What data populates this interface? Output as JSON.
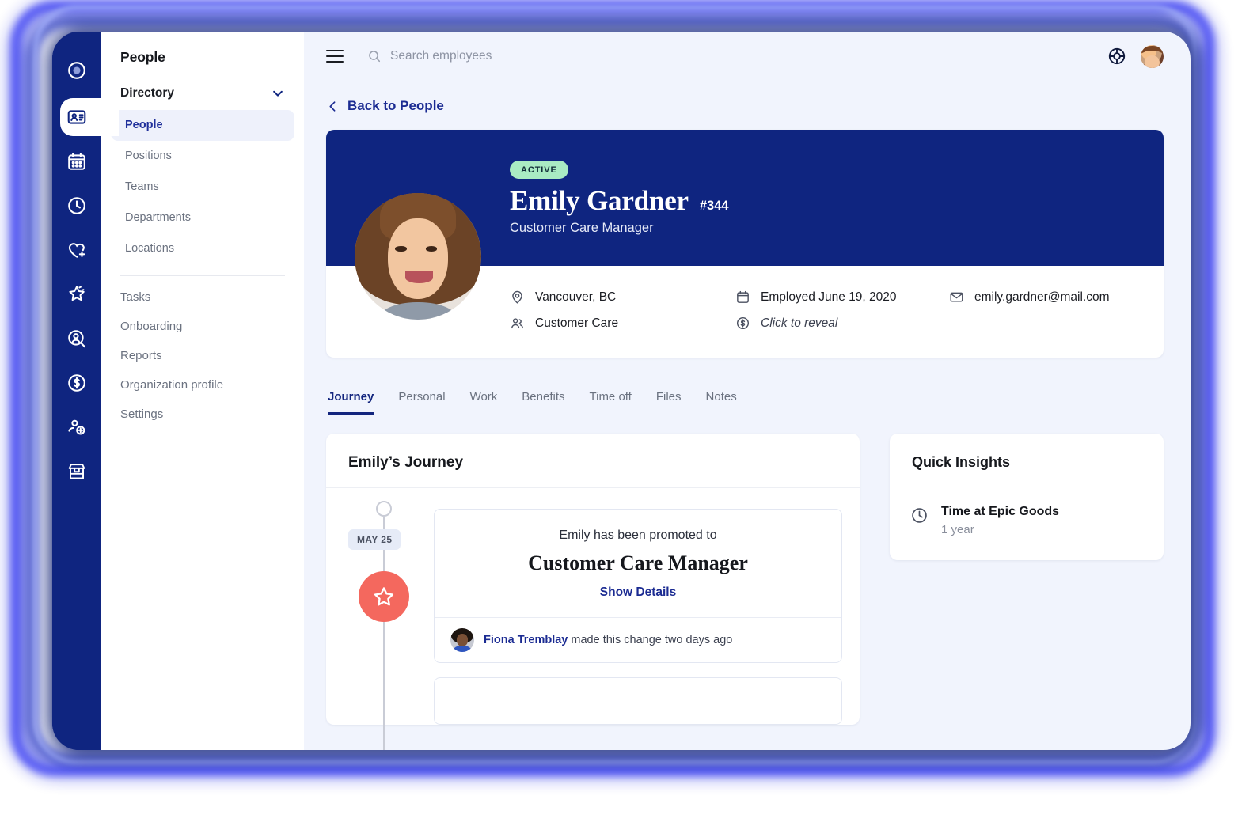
{
  "theme": {
    "navy": "#0f2580",
    "page_bg": "#f1f4fd",
    "accent_link": "#1b2b92",
    "badge_green": "#a9ebc3",
    "marker_coral": "#f4685e"
  },
  "rail": {
    "items": [
      {
        "icon": "logo-icon",
        "name": "app-logo"
      },
      {
        "icon": "id-card-icon",
        "name": "people",
        "active": true
      },
      {
        "icon": "calendar-icon",
        "name": "calendar"
      },
      {
        "icon": "clock-icon",
        "name": "time-tracking"
      },
      {
        "icon": "heart-plus-icon",
        "name": "benefits"
      },
      {
        "icon": "star-badge-icon",
        "name": "performance"
      },
      {
        "icon": "user-search-icon",
        "name": "recruiting"
      },
      {
        "icon": "dollar-circle-icon",
        "name": "payroll"
      },
      {
        "icon": "user-plus-icon",
        "name": "onboarding"
      },
      {
        "icon": "store-icon",
        "name": "marketplace"
      }
    ]
  },
  "subnav": {
    "title": "People",
    "group": {
      "label": "Directory",
      "expanded": true
    },
    "group_links": [
      {
        "label": "People",
        "selected": true
      },
      {
        "label": "Positions",
        "selected": false
      },
      {
        "label": "Teams",
        "selected": false
      },
      {
        "label": "Departments",
        "selected": false
      },
      {
        "label": "Locations",
        "selected": false
      }
    ],
    "items": [
      {
        "label": "Tasks"
      },
      {
        "label": "Onboarding"
      },
      {
        "label": "Reports"
      },
      {
        "label": "Organization profile"
      },
      {
        "label": "Settings"
      }
    ]
  },
  "topbar": {
    "menu_icon": "hamburger-icon",
    "search": {
      "value": "",
      "placeholder": "Search employees",
      "icon": "search-icon"
    },
    "help_icon": "life-ring-help-icon",
    "avatar": "user-avatar"
  },
  "back_link": {
    "label": "Back to People",
    "icon": "chevron-left-icon"
  },
  "profile": {
    "status_badge": "ACTIVE",
    "name": "Emily Gardner",
    "employee_id": "#344",
    "job_title": "Customer Care Manager",
    "facts": [
      {
        "icon": "location-pin-icon",
        "text": "Vancouver, BC",
        "style": "normal"
      },
      {
        "icon": "calendar-icon",
        "text": "Employed June 19, 2020",
        "style": "normal"
      },
      {
        "icon": "envelope-icon",
        "text": "emily.gardner@mail.com",
        "style": "normal"
      },
      {
        "icon": "people-icon",
        "text": "Customer Care",
        "style": "normal"
      },
      {
        "icon": "dollar-circle-icon",
        "text": "Click to reveal",
        "style": "italic"
      }
    ]
  },
  "tabs": [
    {
      "label": "Journey",
      "active": true
    },
    {
      "label": "Personal",
      "active": false
    },
    {
      "label": "Work",
      "active": false
    },
    {
      "label": "Benefits",
      "active": false
    },
    {
      "label": "Time off",
      "active": false
    },
    {
      "label": "Files",
      "active": false
    },
    {
      "label": "Notes",
      "active": false
    }
  ],
  "journey": {
    "title": "Emily’s Journey",
    "event": {
      "date_pill": "MAY 25",
      "marker_icon": "star-icon",
      "lead": "Emily has been promoted to",
      "title": "Customer Care Manager",
      "link": "Show Details",
      "author": "Fiona Tremblay",
      "author_suffix": " made this change two days ago"
    }
  },
  "quick_insights": {
    "title": "Quick Insights",
    "items": [
      {
        "icon": "clock-icon",
        "label": "Time at Epic Goods",
        "value": "1 year"
      }
    ]
  }
}
